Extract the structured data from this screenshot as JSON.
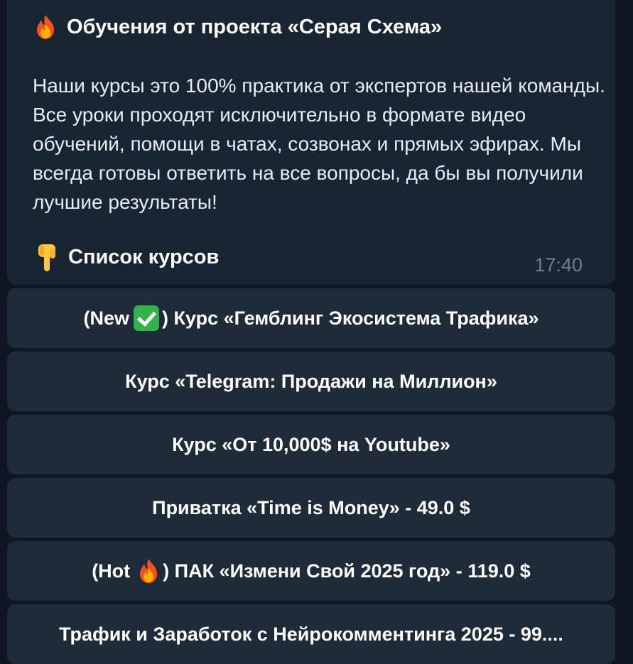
{
  "message": {
    "title": "Обучения от проекта «Серая Схема»",
    "title_icon": "fire-emoji",
    "body": "Наши курсы это 100% практика от экспертов нашей команды. Все уроки проходят исключительно в формате видео обучений, помощи в чатах, созвонах и прямых эфирах. Мы всегда готовы ответить на все вопросы, да бы вы получили лучшие результаты!",
    "list_heading": "Список курсов",
    "list_icon": "pointing-down-hand-emoji",
    "time": "17:40"
  },
  "buttons": [
    {
      "prefix": "(New",
      "icon": "check-mark-emoji",
      "suffix": ") Курс «Гемблинг Экосистема Трафика»"
    },
    {
      "label": "Курс «Telegram: Продажи на Миллион»"
    },
    {
      "label": "Курс «От 10,000$ на Youtube»"
    },
    {
      "label": "Приватка «Time is Money» - 49.0 $"
    },
    {
      "prefix": "(Hot",
      "icon": "fire-emoji",
      "suffix": ") ПАК «Измени Свой 2025 год» - 119.0 $"
    },
    {
      "label": "Трафик и Заработок с Нейрокомментинга 2025 - 99...."
    }
  ],
  "colors": {
    "background": "#0e1621",
    "bubble": "#182533",
    "button": "#1e2c3a",
    "time": "#6d7f8f"
  }
}
